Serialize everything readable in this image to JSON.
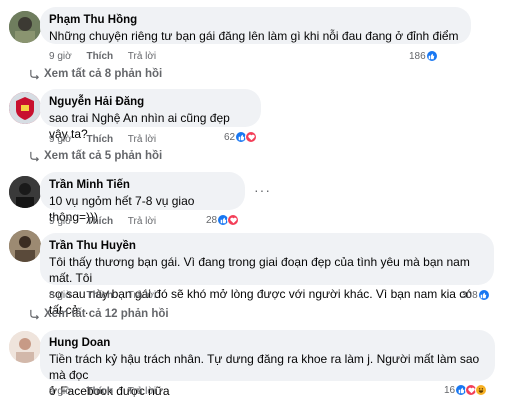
{
  "comments": [
    {
      "author": "Phạm Thu Hồng",
      "text": "Những chuyện riêng tư bạn gái đăng lên làm gì khi nỗi đau đang ở đỉnh điểm",
      "time": "9 giờ",
      "like_label": "Thích",
      "reply_label": "Trả lời",
      "reaction_count": "186",
      "reactions": [
        "like-icon"
      ],
      "more_replies": "Xem tất cả 8 phản hồi",
      "colors": {
        "avatar": "#5b6b4f"
      }
    },
    {
      "author": "Nguyễn Hải Đăng",
      "text": "sao trai Nghệ An nhìn ai cũng đẹp vậy ta?",
      "time": "9 giờ",
      "like_label": "Thích",
      "reply_label": "Trả lời",
      "reaction_count": "62",
      "reactions": [
        "like-icon",
        "heart-icon"
      ],
      "more_replies": "Xem tất cả 5 phản hồi",
      "colors": {
        "avatar": "#c8102e"
      }
    },
    {
      "author": "Trần Minh Tiến",
      "text": "10 vụ ngỏm hết 7-8 vụ giao thông=)))",
      "time": "9 giờ",
      "like_label": "Thích",
      "reply_label": "Trả lời",
      "reaction_count": "28",
      "reactions": [
        "like-icon",
        "heart-icon"
      ],
      "more_icon": "more-horizontal-icon",
      "colors": {
        "avatar": "#2b2b2b"
      }
    },
    {
      "author": "Trần Thu Huyền",
      "text_lines": [
        "Tôi thấy thương bạn gái. Vì đang trong giai đoạn đẹp của tình yêu mà bạn nam mất. Tôi",
        "sợ sau này bạn gái đó sẽ khó mở lòng được với người khác. Vì bạn nam kia có tất cả...."
      ],
      "time": "8 giờ",
      "like_label": "Thích",
      "reply_label": "Trả lời",
      "reaction_count": "308",
      "reactions": [
        "like-icon"
      ],
      "more_replies": "Xem tất cả 12 phản hồi",
      "colors": {
        "avatar": "#6b5a48"
      }
    },
    {
      "author": "Hung Doan",
      "text_lines": [
        "Tiền trách kỷ hậu trách nhân. Tự dưng đăng ra khoe ra làm j. Người mất làm sao mà đọc",
        "ở Facebook được nữa"
      ],
      "time": "9 giờ",
      "like_label": "Thích",
      "reply_label": "Trả lời",
      "reaction_count": "16",
      "reactions": [
        "like-icon",
        "heart-icon",
        "haha-icon"
      ],
      "colors": {
        "avatar": "#e8d8d0"
      }
    }
  ],
  "colors": {
    "bubble_bg": "#f0f2f5",
    "secondary_text": "#65676b",
    "like_blue": "#1877f2",
    "heart_red": "#f33e58",
    "haha_yellow": "#f7b125"
  }
}
